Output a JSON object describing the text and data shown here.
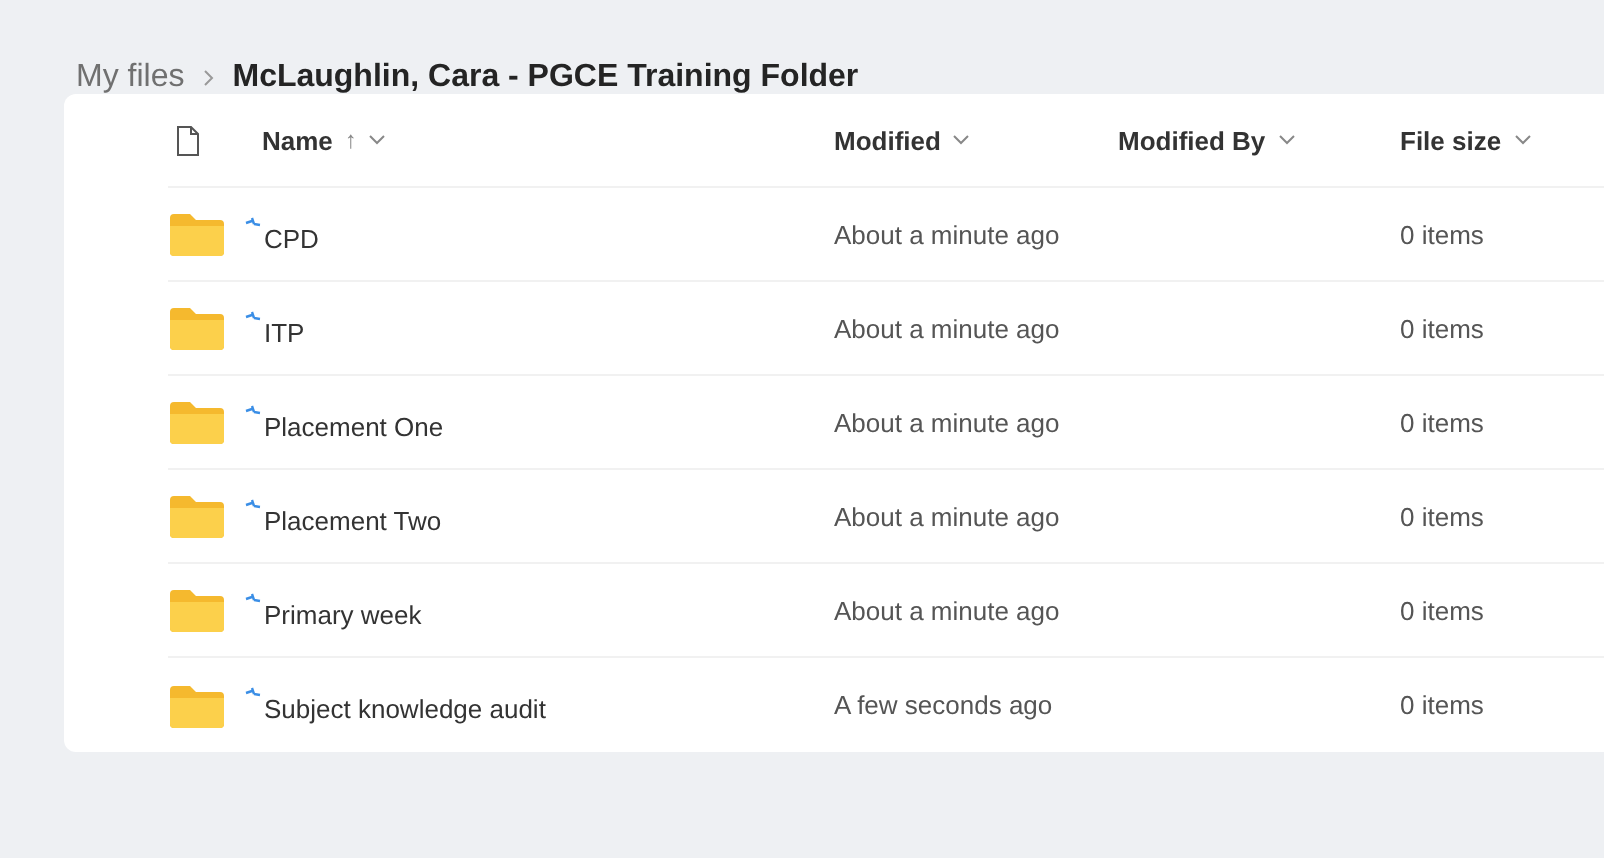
{
  "breadcrumb": [
    {
      "label": "My files",
      "current": false
    },
    {
      "label": "McLaughlin, Cara - PGCE Training Folder",
      "current": true
    }
  ],
  "table": {
    "columns": [
      {
        "label": "Name",
        "sort_indicator": "↑"
      },
      {
        "label": "Modified"
      },
      {
        "label": "Modified By"
      },
      {
        "label": "File size"
      }
    ],
    "rows": [
      {
        "name": "CPD",
        "modified": "About a minute ago",
        "size": "0 items",
        "new": true
      },
      {
        "name": "ITP",
        "modified": "About a minute ago",
        "size": "0 items",
        "new": true
      },
      {
        "name": "Placement One",
        "modified": "About a minute ago",
        "size": "0 items",
        "new": true
      },
      {
        "name": "Placement Two",
        "modified": "About a minute ago",
        "size": "0 items",
        "new": true
      },
      {
        "name": "Primary week",
        "modified": "About a minute ago",
        "size": "0 items",
        "new": true
      },
      {
        "name": "Subject knowledge audit",
        "modified": "A few seconds ago",
        "size": "0 items",
        "new": true
      }
    ]
  }
}
